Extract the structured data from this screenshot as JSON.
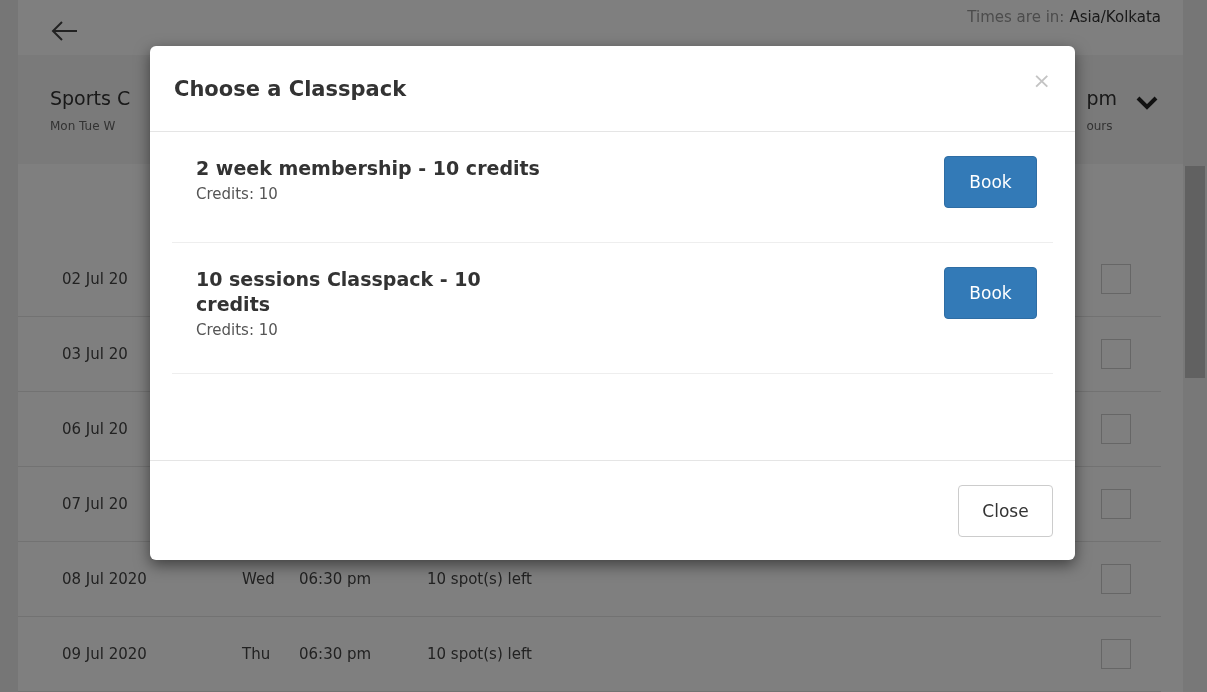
{
  "top_bar": {
    "timezone_label": "Times are in:",
    "timezone_value": "Asia/Kolkata"
  },
  "class_header": {
    "title": "Sports C",
    "days": "Mon Tue W",
    "time": "pm",
    "duration": "ours",
    "expanded": false
  },
  "sessions": [
    {
      "date": "02 Jul 20",
      "checked": false
    },
    {
      "date": "03 Jul 20",
      "checked": false
    },
    {
      "date": "06 Jul 20",
      "checked": false
    },
    {
      "date": "07 Jul 20",
      "checked": false
    },
    {
      "date": "08 Jul 2020",
      "day": "Wed",
      "time": "06:30 pm",
      "spots": "10 spot(s) left",
      "checked": false
    },
    {
      "date": "09 Jul 2020",
      "day": "Thu",
      "time": "06:30 pm",
      "spots": "10 spot(s) left",
      "checked": false
    }
  ],
  "modal": {
    "title": "Choose a Classpack",
    "close_icon": "×",
    "classpacks": [
      {
        "name": "2 week membership - 10 credits",
        "credits": "Credits: 10",
        "button": "Book"
      },
      {
        "name": "10 sessions Classpack - 10 credits",
        "credits": "Credits: 10",
        "button": "Book"
      }
    ],
    "footer_button": "Close"
  }
}
